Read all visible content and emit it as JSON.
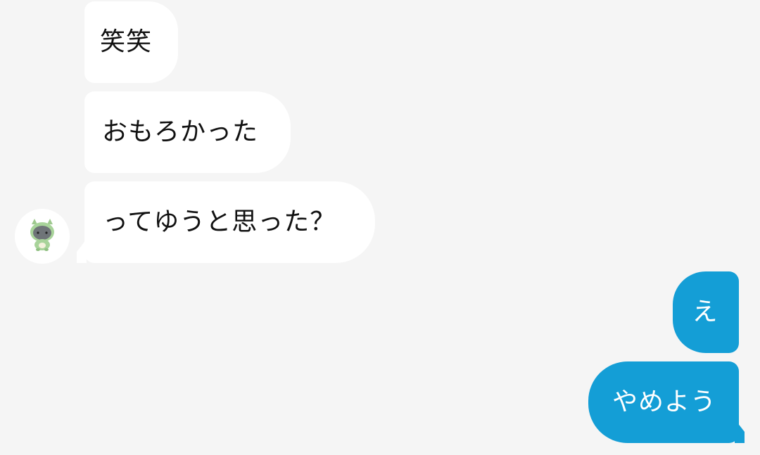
{
  "messages": {
    "incoming": [
      {
        "text": "笑笑"
      },
      {
        "text": "おもろかった"
      },
      {
        "text": "ってゆうと思った？"
      }
    ],
    "outgoing": [
      {
        "text": "え"
      },
      {
        "text": "やめよう"
      }
    ]
  },
  "contact": {
    "avatar_icon": "dragon-character-icon"
  },
  "colors": {
    "background": "#f5f5f5",
    "incoming_bubble": "#ffffff",
    "outgoing_bubble": "#149ed6",
    "incoming_text": "#111111",
    "outgoing_text": "#ffffff"
  }
}
